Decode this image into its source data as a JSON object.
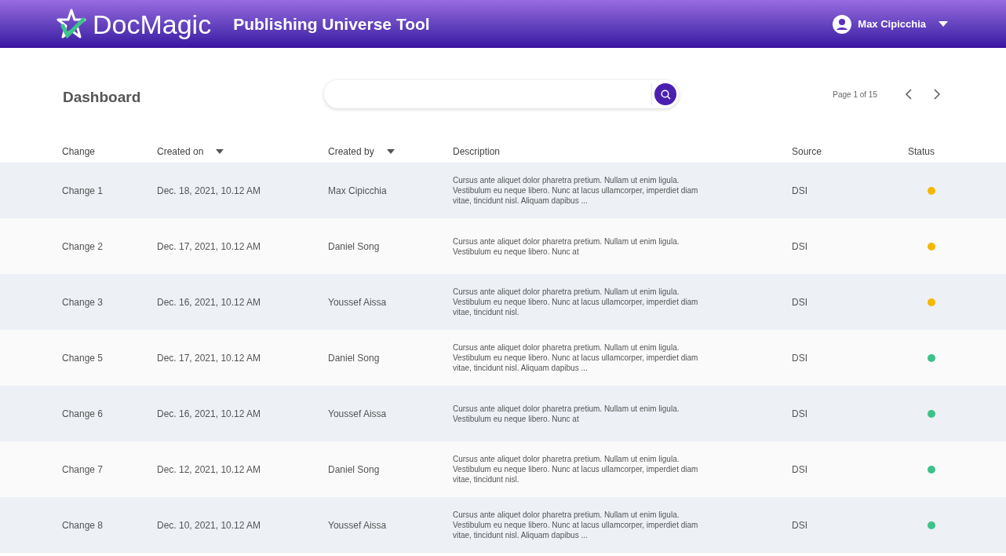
{
  "header": {
    "brand": "DocMagic",
    "app_title": "Publishing Universe Tool",
    "user": "Max Cipicchia"
  },
  "page_title": "Dashboard",
  "pagination": {
    "label": "Page 1 of 15"
  },
  "table": {
    "columns": [
      {
        "label": "Change",
        "sortable": false
      },
      {
        "label": "Created on",
        "sortable": true
      },
      {
        "label": "Created by",
        "sortable": true
      },
      {
        "label": "Description",
        "sortable": false
      },
      {
        "label": "Source",
        "sortable": false
      },
      {
        "label": "Status",
        "sortable": false
      }
    ],
    "rows": [
      {
        "change": "Change 1",
        "created_on": "Dec. 18, 2021, 10.12 AM",
        "created_by": "Max Cipicchia",
        "description": "Cursus ante aliquet dolor pharetra pretium. Nullam ut enim ligula. Vestibulum eu neque libero. Nunc at lacus ullamcorper, imperdiet diam vitae, tincidunt nisl. Aliquam dapibus ...",
        "source": "DSI",
        "color": "#f5b800"
      },
      {
        "change": "Change 2",
        "created_on": "Dec. 17, 2021, 10.12 AM",
        "created_by": "Daniel Song",
        "description": "Cursus ante aliquet dolor pharetra pretium. Nullam ut enim ligula. Vestibulum eu neque libero. Nunc at",
        "source": "DSI",
        "color": "#f5b800"
      },
      {
        "change": "Change 3",
        "created_on": "Dec. 16, 2021, 10.12 AM",
        "created_by": "Youssef Aissa",
        "description": "Cursus ante aliquet dolor pharetra pretium. Nullam ut enim ligula. Vestibulum eu neque libero. Nunc at lacus ullamcorper, imperdiet diam vitae, tincidunt nisl.",
        "source": "DSI",
        "color": "#f5b800"
      },
      {
        "change": "Change 5",
        "created_on": "Dec. 17, 2021, 10.12 AM",
        "created_by": "Daniel Song",
        "description": "Cursus ante aliquet dolor pharetra pretium. Nullam ut enim ligula. Vestibulum eu neque libero. Nunc at lacus ullamcorper, imperdiet diam vitae, tincidunt nisl. Aliquam dapibus ...",
        "source": "DSI",
        "color": "#3cc28a"
      },
      {
        "change": "Change 6",
        "created_on": "Dec. 16, 2021, 10.12 AM",
        "created_by": "Youssef Aissa",
        "description": "Cursus ante aliquet dolor pharetra pretium. Nullam ut enim ligula. Vestibulum eu neque libero. Nunc at",
        "source": "DSI",
        "color": "#3cc28a"
      },
      {
        "change": "Change 7",
        "created_on": "Dec. 12, 2021, 10.12 AM",
        "created_by": "Daniel Song",
        "description": "Cursus ante aliquet dolor pharetra pretium. Nullam ut enim ligula. Vestibulum eu neque libero. Nunc at lacus ullamcorper, imperdiet diam vitae, tincidunt nisl.",
        "source": "DSI",
        "color": "#3cc28a"
      },
      {
        "change": "Change 8",
        "created_on": "Dec. 10, 2021, 10.12 AM",
        "created_by": "Youssef Aissa",
        "description": "Cursus ante aliquet dolor pharetra pretium. Nullam ut enim ligula. Vestibulum eu neque libero. Nunc at lacus ullamcorper, imperdiet diam vitae, tincidunt nisl. Aliquam dapibus ...",
        "source": "DSI",
        "color": "#3cc28a"
      }
    ]
  }
}
